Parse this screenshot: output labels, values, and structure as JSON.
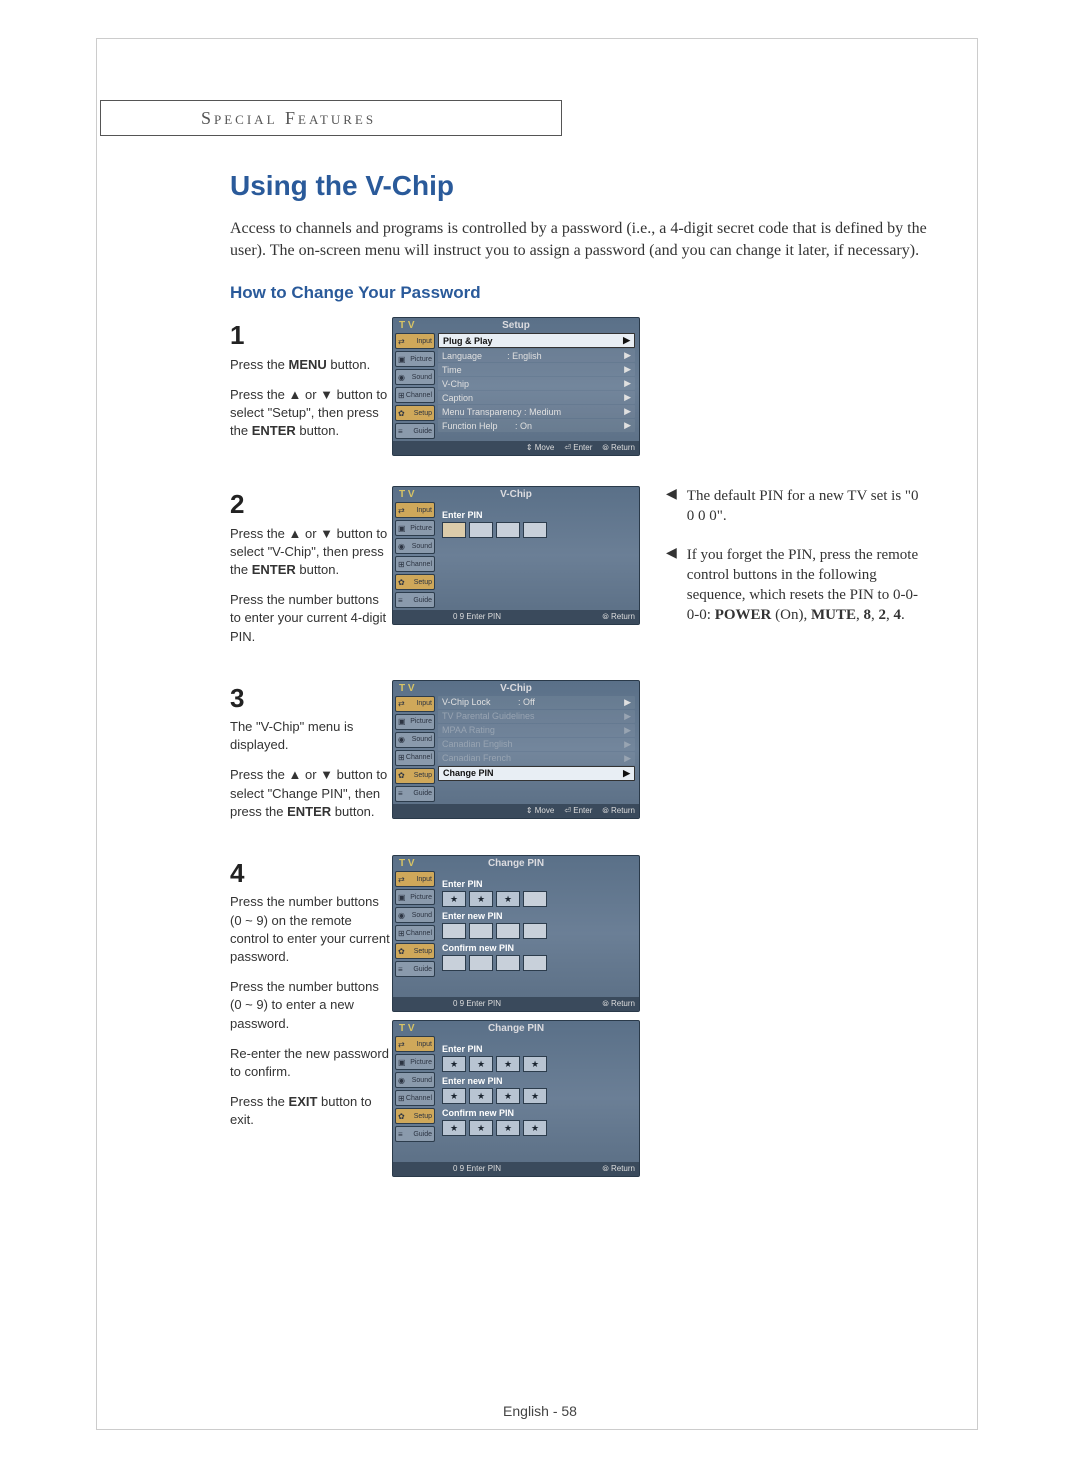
{
  "header": "Special Features",
  "title": "Using the V-Chip",
  "intro": "Access to channels and programs is controlled by a password (i.e., a 4-digit secret code that is defined by the user). The on-screen menu will instruct you to assign a password (and you can change it later, if necessary).",
  "subtitle": "How to Change Your Password",
  "steps": {
    "s1": {
      "num": "1",
      "p1": "Press the MENU button.",
      "p2": "Press the ▲ or ▼ button to select \"Setup\", then press the ENTER button."
    },
    "s2": {
      "num": "2",
      "p1": "Press the ▲ or ▼ button to select \"V-Chip\", then press the ENTER button.",
      "p2": "Press the number buttons to enter your current 4-digit PIN."
    },
    "s3": {
      "num": "3",
      "p1": "The \"V-Chip\" menu is displayed.",
      "p2": "Press the ▲ or ▼ button to select \"Change PIN\", then press the ENTER button."
    },
    "s4": {
      "num": "4",
      "p1": "Press the number buttons (0 ~ 9) on the remote control to enter your current password.",
      "p2": "Press the number buttons (0 ~ 9) to enter a new password.",
      "p3": "Re-enter the new password to confirm.",
      "p4": "Press the EXIT button to exit."
    }
  },
  "osd": {
    "tv": "T V",
    "tabs": {
      "input": "Input",
      "picture": "Picture",
      "sound": "Sound",
      "channel": "Channel",
      "setup": "Setup",
      "guide": "Guide"
    },
    "setup": {
      "title": "Setup",
      "items": [
        {
          "l": "Plug & Play",
          "r": "▶",
          "hl": true
        },
        {
          "l": "Language",
          "m": ": English",
          "r": "▶"
        },
        {
          "l": "Time",
          "r": "▶"
        },
        {
          "l": "V-Chip",
          "r": "▶"
        },
        {
          "l": "Caption",
          "r": "▶"
        },
        {
          "l": "Menu Transparency :",
          "m": "Medium",
          "r": "▶"
        },
        {
          "l": "Function Help",
          "m": ": On",
          "r": "▶"
        }
      ],
      "foot": [
        "⇕ Move",
        "⏎ Enter",
        "⦾ Return"
      ]
    },
    "vchip_pin": {
      "title": "V-Chip",
      "label": "Enter PIN",
      "foot": [
        "0 9 Enter PIN",
        "⦾ Return"
      ]
    },
    "vchip_menu": {
      "title": "V-Chip",
      "items": [
        {
          "l": "V-Chip Lock",
          "m": ": Off",
          "r": "▶"
        },
        {
          "l": "TV Parental Guidelines",
          "r": "▶",
          "dim": true
        },
        {
          "l": "MPAA Rating",
          "r": "▶",
          "dim": true
        },
        {
          "l": "Canadian English",
          "r": "▶",
          "dim": true
        },
        {
          "l": "Canadian French",
          "r": "▶",
          "dim": true
        },
        {
          "l": "Change PIN",
          "r": "▶",
          "hl": true
        }
      ],
      "foot": [
        "⇕ Move",
        "⏎ Enter",
        "⦾ Return"
      ]
    },
    "change_pin": {
      "title": "Change PIN",
      "l1": "Enter PIN",
      "l2": "Enter new PIN",
      "l3": "Confirm new PIN",
      "foot": [
        "0 9 Enter PIN",
        "⦾ Return"
      ]
    }
  },
  "sidebar": {
    "n1": "The default PIN for a new TV set is \"0 0 0 0\".",
    "n2a": "If you forget the PIN, press the remote control buttons in the following sequence, which resets the PIN to 0-0-0-0: ",
    "n2b": "POWER (On), MUTE, 8, 2, 4."
  },
  "footer": "English - 58"
}
